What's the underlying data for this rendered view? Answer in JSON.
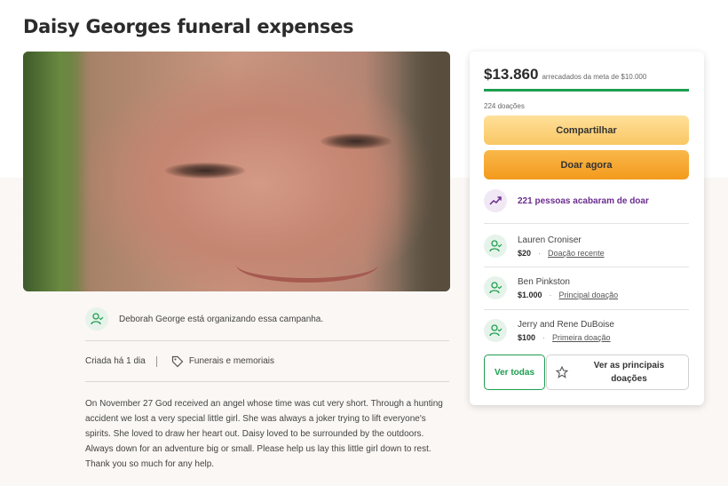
{
  "page": {
    "title": "Daisy Georges funeral expenses"
  },
  "organizer": {
    "text": "Deborah George está organizando essa campanha.",
    "icon": "user-icon"
  },
  "meta": {
    "created": "Criada há 1 dia",
    "category": "Funerais e memoriais",
    "category_icon": "tag-icon"
  },
  "description": "On November 27 God received an angel whose time was cut very short. Through a hunting accident we lost a very special little girl. She was always a joker trying to lift everyone's spirits. She loved to draw her heart out. Daisy loved to be surrounded by the outdoors. Always down for an adventure big or small. Please help us lay this little girl down to rest. Thank you so much for any help.",
  "card": {
    "amount": "$13.860",
    "goal_text": "arrecadados da meta de $10.000",
    "progress_fraction": 1.0,
    "donation_count": "224 doações",
    "share_label": "Compartilhar",
    "donate_label": "Doar agora",
    "trend_text": "221 pessoas acabaram de doar",
    "donors": [
      {
        "name": "Lauren Croniser",
        "amount": "$20",
        "tag": "Doação recente"
      },
      {
        "name": "Ben Pinkston",
        "amount": "$1.000",
        "tag": "Principal doação"
      },
      {
        "name": "Jerry and Rene DuBoise",
        "amount": "$100",
        "tag": "Primeira doação"
      }
    ],
    "see_all_label": "Ver todas",
    "see_top_label": "Ver as principais doações"
  },
  "colors": {
    "accent_green": "#1e9e4f",
    "share_button": "#f9c764",
    "donate_button": "#f39a1c",
    "trend_purple": "#6b2d8f"
  }
}
